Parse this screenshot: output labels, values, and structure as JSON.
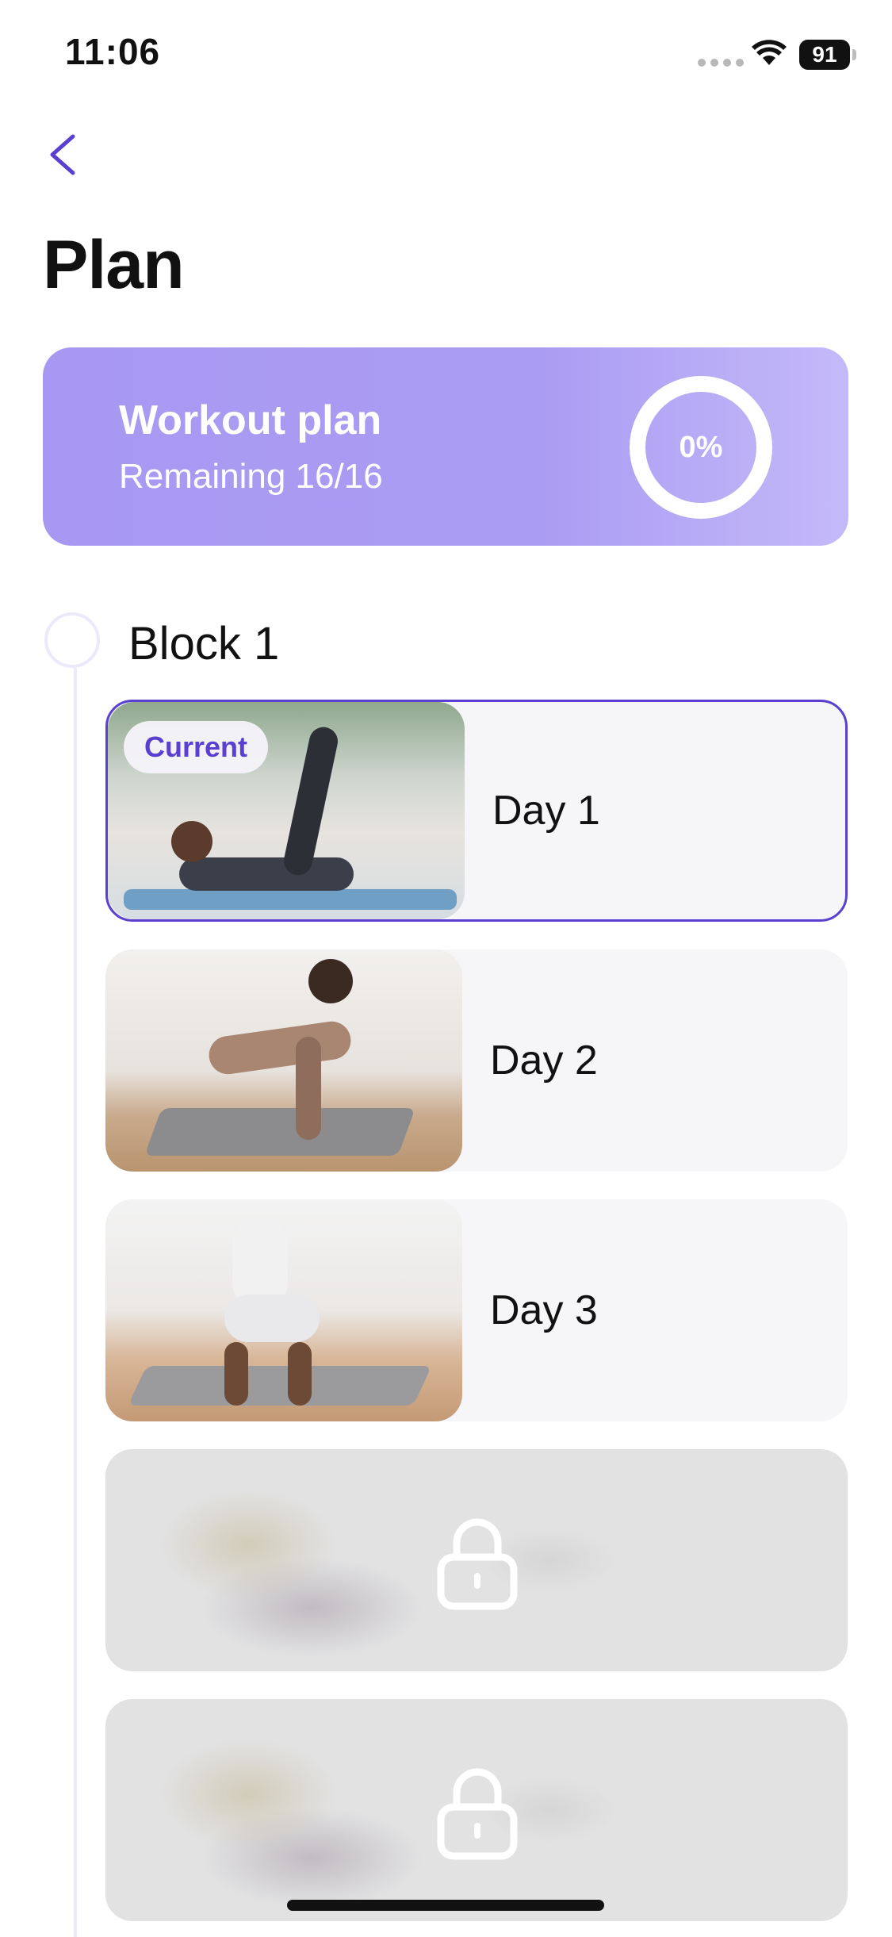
{
  "status_bar": {
    "time": "11:06",
    "battery": "91"
  },
  "header": {
    "back_icon": "chevron-left-icon",
    "title": "Plan"
  },
  "plan_card": {
    "title": "Workout plan",
    "subtitle": "Remaining 16/16",
    "progress_text": "0%",
    "progress_value": 0
  },
  "block": {
    "title": "Block 1"
  },
  "days": [
    {
      "label": "Day 1",
      "badge": "Current",
      "state": "current"
    },
    {
      "label": "Day 2",
      "state": "unlocked"
    },
    {
      "label": "Day 3",
      "state": "unlocked"
    },
    {
      "state": "locked",
      "icon": "lock-icon"
    },
    {
      "state": "locked",
      "icon": "lock-icon"
    }
  ],
  "colors": {
    "accent": "#5a3fd1",
    "card_gradient_start": "#a898f2",
    "card_gradient_end": "#c4b9f8",
    "timeline": "#ece9fb"
  }
}
